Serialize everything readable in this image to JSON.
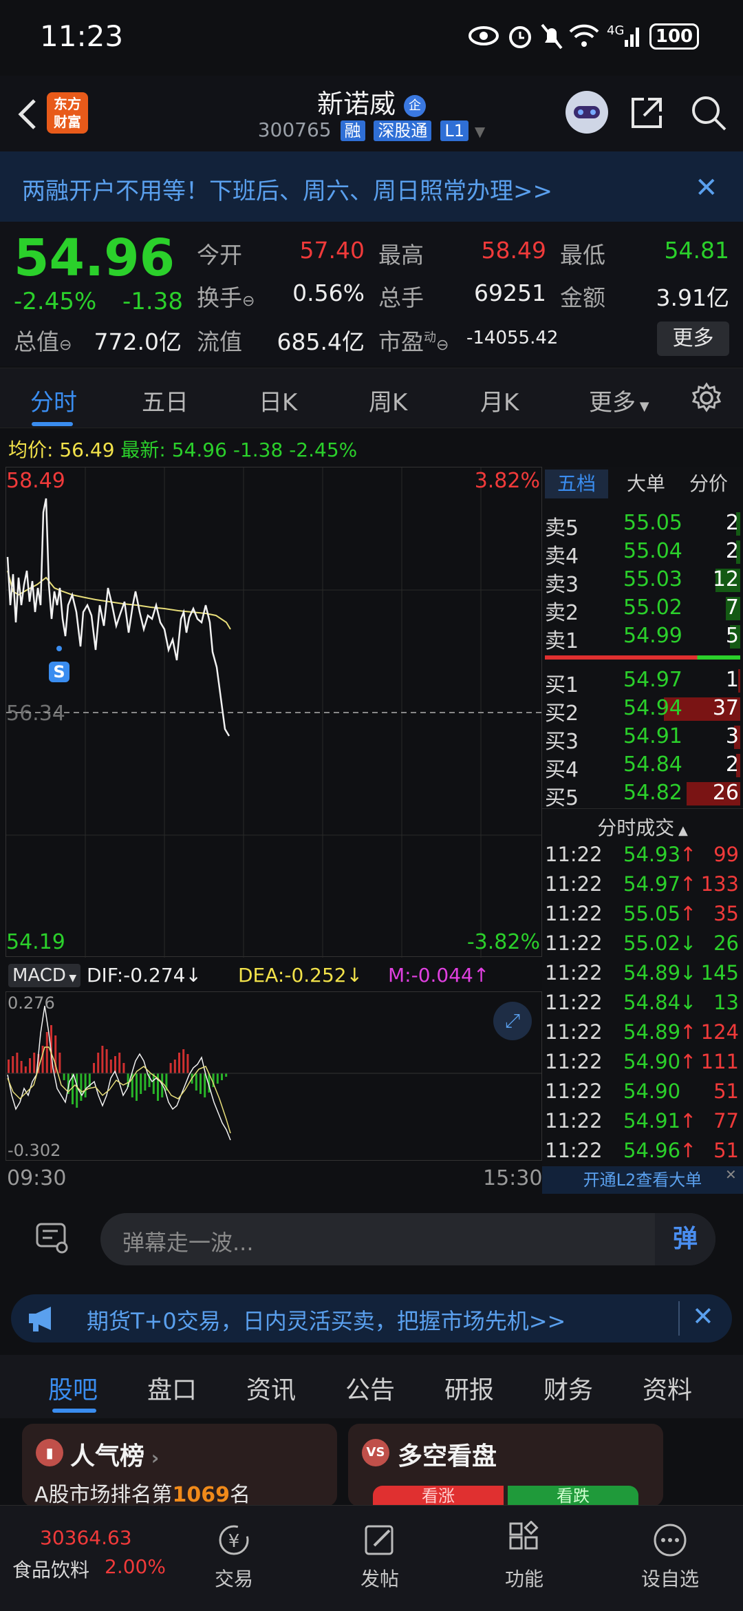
{
  "status_bar": {
    "time": "11:23",
    "battery": "100"
  },
  "header": {
    "logo_line1": "东方",
    "logo_line2": "财富",
    "stock_name": "新诺威",
    "stock_code": "300765",
    "tags": [
      "融",
      "深股通",
      "L1"
    ],
    "badge": "企"
  },
  "banner": {
    "text": "两融开户不用等！下班后、周六、周日照常办理>>"
  },
  "quote": {
    "last_price": "54.96",
    "change_pct": "-2.45%",
    "change_amt": "-1.38",
    "open_label": "今开",
    "open": "57.40",
    "high_label": "最高",
    "high": "58.49",
    "low_label": "最低",
    "low": "54.81",
    "turnover_label": "换手",
    "turnover": "0.56%",
    "volume_label": "总手",
    "volume": "69251",
    "amount_label": "金额",
    "amount": "3.91亿",
    "mktcap_label": "总值",
    "mktcap": "772.0亿",
    "float_label": "流值",
    "float_cap": "685.4亿",
    "pe_label": "市盈",
    "pe_sup": "动",
    "pe": "-14055.42",
    "more_label": "更多"
  },
  "chart_tabs": [
    "分时",
    "五日",
    "日K",
    "周K",
    "月K",
    "更多"
  ],
  "avg_line": {
    "avg_label": "均价:",
    "avg": "56.49",
    "latest_label": "最新:",
    "latest": "54.96",
    "chg": "-1.38",
    "pct": "-2.45%"
  },
  "chart": {
    "y_max": "58.49",
    "y_min": "54.19",
    "pct_max": "3.82%",
    "pct_min": "-3.82%",
    "ref": "56.34",
    "marker": "S",
    "time_start": "09:30",
    "time_end": "15:30"
  },
  "macd": {
    "name": "MACD",
    "dif": "DIF:-0.274",
    "dea": "DEA:-0.252",
    "m": "M:-0.044",
    "top": "0.276",
    "bottom": "-0.302"
  },
  "order_tabs": [
    "五档",
    "大单",
    "分价"
  ],
  "asks": [
    {
      "label": "卖5",
      "price": "55.05",
      "vol": "2"
    },
    {
      "label": "卖4",
      "price": "55.04",
      "vol": "2"
    },
    {
      "label": "卖3",
      "price": "55.03",
      "vol": "12"
    },
    {
      "label": "卖2",
      "price": "55.02",
      "vol": "7"
    },
    {
      "label": "卖1",
      "price": "54.99",
      "vol": "5"
    }
  ],
  "bids": [
    {
      "label": "买1",
      "price": "54.97",
      "vol": "1"
    },
    {
      "label": "买2",
      "price": "54.94",
      "vol": "37"
    },
    {
      "label": "买3",
      "price": "54.91",
      "vol": "3"
    },
    {
      "label": "买4",
      "price": "54.84",
      "vol": "2"
    },
    {
      "label": "买5",
      "price": "54.82",
      "vol": "26"
    }
  ],
  "trades_title": "分时成交",
  "trades": [
    {
      "time": "11:22",
      "price": "54.93",
      "dir": "↑",
      "vol": "99"
    },
    {
      "time": "11:22",
      "price": "54.97",
      "dir": "↑",
      "vol": "133"
    },
    {
      "time": "11:22",
      "price": "55.05",
      "dir": "↑",
      "vol": "35"
    },
    {
      "time": "11:22",
      "price": "55.02",
      "dir": "↓",
      "vol": "26"
    },
    {
      "time": "11:22",
      "price": "54.89",
      "dir": "↓",
      "vol": "145"
    },
    {
      "time": "11:22",
      "price": "54.84",
      "dir": "↓",
      "vol": "13"
    },
    {
      "time": "11:22",
      "price": "54.89",
      "dir": "↑",
      "vol": "124"
    },
    {
      "time": "11:22",
      "price": "54.90",
      "dir": "↑",
      "vol": "111"
    },
    {
      "time": "11:22",
      "price": "54.90",
      "dir": "",
      "vol": "51"
    },
    {
      "time": "11:22",
      "price": "54.91",
      "dir": "↑",
      "vol": "77"
    },
    {
      "time": "11:22",
      "price": "54.96",
      "dir": "↑",
      "vol": "51"
    }
  ],
  "l2_link": "开通L2查看大单",
  "danmu": {
    "placeholder": "弹幕走一波...",
    "send": "弹"
  },
  "futures_banner": "期货T+0交易，日内灵活买卖，把握市场先机>>",
  "bottom_tabs": [
    "股吧",
    "盘口",
    "资讯",
    "公告",
    "研报",
    "财务",
    "资料"
  ],
  "cards": {
    "popularity_title": "人气榜",
    "popularity_text_prefix": "A股市场排名第",
    "popularity_rank": "1069",
    "popularity_suffix": "名",
    "longshort_title": "多空看盘",
    "bull": "看涨",
    "bear": "看跌"
  },
  "bottom_nav": {
    "index_value": "30364.63",
    "index_name": "食品饮料",
    "index_pct": "2.00%",
    "items": [
      "交易",
      "发帖",
      "功能",
      "设自选"
    ]
  }
}
